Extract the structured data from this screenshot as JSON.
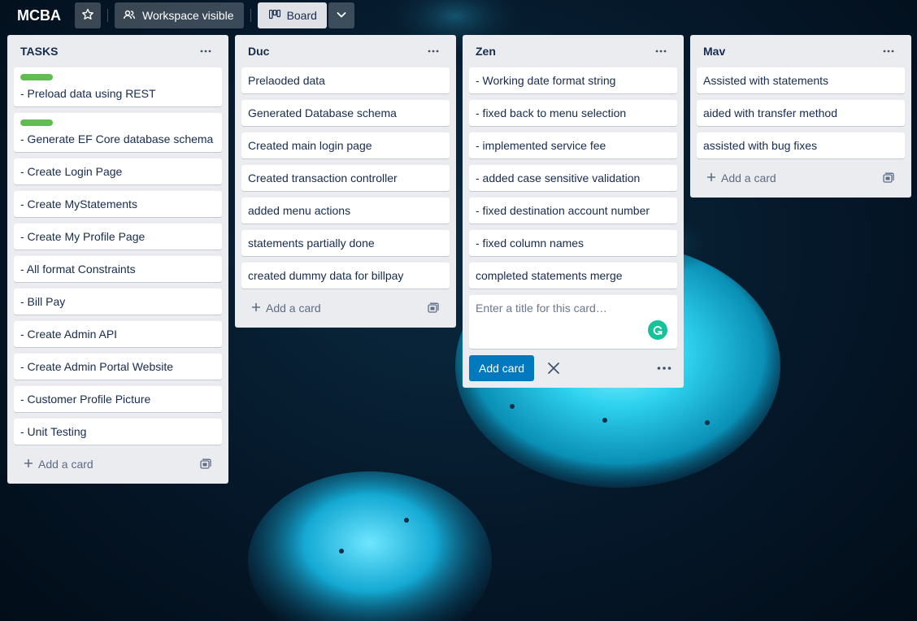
{
  "board": {
    "title": "MCBA",
    "visibility_label": "Workspace visible",
    "view_label": "Board"
  },
  "lists": {
    "tasks": {
      "title": "TASKS",
      "label_color": "#61bd4f",
      "cards": [
        "- Preload data using REST",
        "- Generate EF Core database schema",
        "- Create Login Page",
        "- Create MyStatements",
        "- Create My Profile Page",
        "- All format Constraints",
        "- Bill Pay",
        "- Create Admin API",
        "- Create Admin Portal Website",
        "- Customer Profile Picture",
        "- Unit Testing"
      ],
      "add_label": "Add a card"
    },
    "duc": {
      "title": "Duc",
      "cards": [
        "Prelaoded data",
        "Generated Database schema",
        "Created main login page",
        "Created transaction controller",
        "added menu actions",
        "statements partially done",
        "created dummy data for billpay"
      ],
      "add_label": "Add a card"
    },
    "zen": {
      "title": "Zen",
      "cards": [
        "- Working date format string",
        "- fixed back to menu selection",
        "- implemented service fee",
        "- added case sensitive validation",
        "- fixed destination account number",
        "- fixed column names",
        "completed statements merge"
      ],
      "composer_placeholder": "Enter a title for this card…",
      "add_button": "Add card"
    },
    "mav": {
      "title": "Mav",
      "cards": [
        "Assisted with statements",
        "aided with transfer method",
        "assisted with bug fixes"
      ],
      "add_label": "Add a card"
    }
  },
  "colors": {
    "list_bg": "#ebecf0",
    "accent_blue": "#0079bf",
    "grammarly_green": "#15c39a"
  }
}
